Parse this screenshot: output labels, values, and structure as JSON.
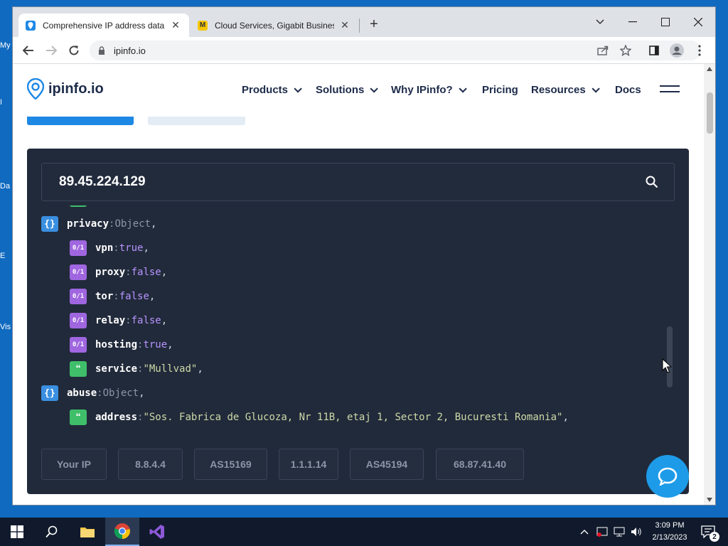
{
  "desktop": {
    "icons": [
      {
        "label": "My"
      },
      {
        "label": "I"
      },
      {
        "label": "Da"
      },
      {
        "label": "E"
      },
      {
        "label": "Vis"
      }
    ]
  },
  "browser": {
    "tabs": [
      {
        "title": "Comprehensive IP address data, I",
        "favicon_color": "#1e88e5",
        "active": true
      },
      {
        "title": "Cloud Services, Gigabit Business",
        "favicon_color": "#f6c700",
        "active": false
      }
    ],
    "new_tab_label": "+",
    "url": "ipinfo.io"
  },
  "site": {
    "logo_text": "ipinfo.io",
    "nav": [
      {
        "label": "Products",
        "dropdown": true
      },
      {
        "label": "Solutions",
        "dropdown": true
      },
      {
        "label": "Why IPinfo?",
        "dropdown": true
      },
      {
        "label": "Pricing",
        "dropdown": false
      },
      {
        "label": "Resources",
        "dropdown": true
      },
      {
        "label": "Docs",
        "dropdown": false
      }
    ]
  },
  "lookup": {
    "ip": "89.45.224.129",
    "json_lines": [
      {
        "indent": 0,
        "badge": "obj",
        "key": "privacy",
        "value": "Object",
        "vtype": "obj"
      },
      {
        "indent": 1,
        "badge": "bool",
        "key": "vpn",
        "value": "true",
        "vtype": "bool"
      },
      {
        "indent": 1,
        "badge": "bool",
        "key": "proxy",
        "value": "false",
        "vtype": "bool"
      },
      {
        "indent": 1,
        "badge": "bool",
        "key": "tor",
        "value": "false",
        "vtype": "bool"
      },
      {
        "indent": 1,
        "badge": "bool",
        "key": "relay",
        "value": "false",
        "vtype": "bool"
      },
      {
        "indent": 1,
        "badge": "bool",
        "key": "hosting",
        "value": "true",
        "vtype": "bool"
      },
      {
        "indent": 1,
        "badge": "str",
        "key": "service",
        "value": "\"Mullvad\"",
        "vtype": "str"
      },
      {
        "indent": 0,
        "badge": "obj",
        "key": "abuse",
        "value": "Object",
        "vtype": "obj"
      },
      {
        "indent": 1,
        "badge": "str",
        "key": "address",
        "value": "\"Sos. Fabrica de Glucoza, Nr 11B, etaj 1, Sector 2, Bucuresti Romania\"",
        "vtype": "str"
      }
    ],
    "badge_glyphs": {
      "obj": "{}",
      "bool": "0/1",
      "str": "❝"
    },
    "quick_chips": [
      "Your IP",
      "8.8.4.4",
      "AS15169",
      "1.1.1.14",
      "AS45194",
      "68.87.41.40"
    ]
  },
  "taskbar": {
    "time": "3:09 PM",
    "date": "2/13/2023",
    "notification_count": "2"
  },
  "colors": {
    "brand_blue": "#1e88e5",
    "panel_bg": "#212a3a",
    "chat_bubble": "#1e9be8"
  }
}
